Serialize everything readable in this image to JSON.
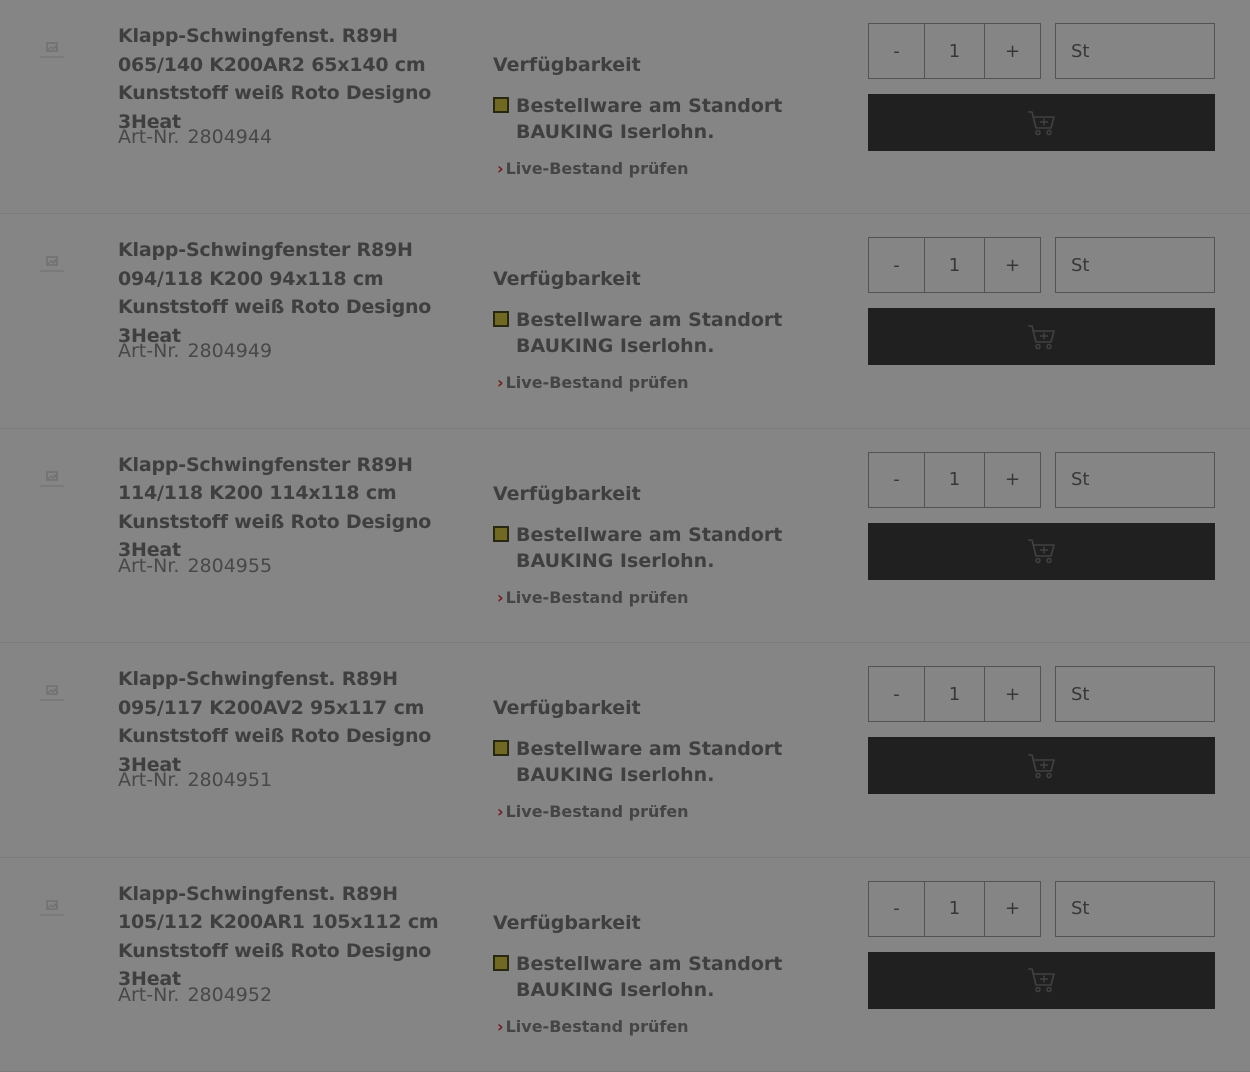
{
  "labels": {
    "availability_heading": "Verfügbarkeit",
    "art_nr_label": "Art-Nr.",
    "live_stock_link": "Live-Bestand prüfen",
    "qty_minus": "-",
    "qty_plus": "+"
  },
  "colors": {
    "availability_indicator": "#d8c844",
    "cart_button": "#3f3f3f",
    "link_chevron": "#d73a3a",
    "overlay": "rgba(0,0,0,0.48)"
  },
  "icons": {
    "thumbnail": "image-placeholder-icon",
    "cart": "shopping-cart-add-icon",
    "chevron": "chevron-right-icon"
  },
  "products": [
    {
      "title": "Klapp-Schwingfenst. R89H 065/140 K200AR2 65x140 cm Kunststoff weiß Roto Designo 3Heat",
      "art_nr": "2804944",
      "availability": "Bestellware am Standort BAUKING Iserlohn.",
      "quantity": "1",
      "unit": "St"
    },
    {
      "title": "Klapp-Schwingfenster R89H 094/118 K200 94x118 cm Kunststoff weiß Roto Designo 3Heat",
      "art_nr": "2804949",
      "availability": "Bestellware am Standort BAUKING Iserlohn.",
      "quantity": "1",
      "unit": "St"
    },
    {
      "title": "Klapp-Schwingfenster R89H 114/118 K200 114x118 cm Kunststoff weiß Roto Designo 3Heat",
      "art_nr": "2804955",
      "availability": "Bestellware am Standort BAUKING Iserlohn.",
      "quantity": "1",
      "unit": "St"
    },
    {
      "title": "Klapp-Schwingfenst. R89H 095/117 K200AV2 95x117 cm Kunststoff weiß Roto Designo 3Heat",
      "art_nr": "2804951",
      "availability": "Bestellware am Standort BAUKING Iserlohn.",
      "quantity": "1",
      "unit": "St"
    },
    {
      "title": "Klapp-Schwingfenst. R89H 105/112 K200AR1 105x112 cm Kunststoff weiß Roto Designo 3Heat",
      "art_nr": "2804952",
      "availability": "Bestellware am Standort BAUKING Iserlohn.",
      "quantity": "1",
      "unit": "St"
    }
  ]
}
